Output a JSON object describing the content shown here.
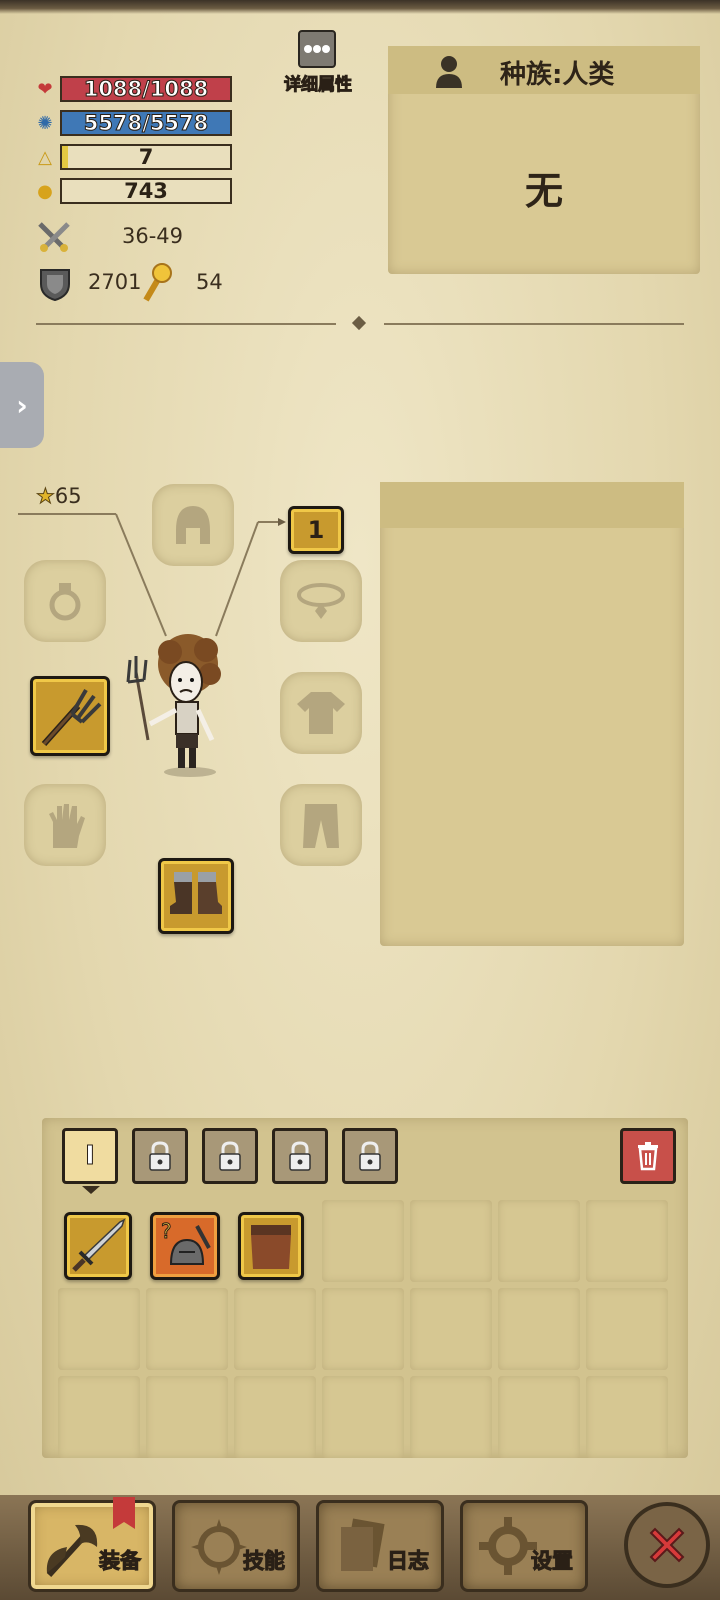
{
  "stats": {
    "hp": "1088/1088",
    "hp_fraction": 1.0,
    "mana": "5578/5578",
    "mana_fraction": 1.0,
    "level": "7",
    "gold": "743",
    "attack": "36-49",
    "armor": "2701",
    "luck": "54"
  },
  "details_button": {
    "label": "详细属性"
  },
  "race_panel": {
    "title": "种族:人类",
    "value": "无"
  },
  "character": {
    "star_value": "65",
    "slot_badge": "1"
  },
  "inventory": {
    "active_tab": "I"
  },
  "bottom_nav": {
    "equipment": "装备",
    "skills": "技能",
    "log": "日志",
    "settings": "设置"
  },
  "colors": {
    "hp_bar": "#c0404a",
    "mana_bar": "#3f78b6",
    "level_bar": "#e3c842",
    "close_button": "#d73a3a"
  }
}
